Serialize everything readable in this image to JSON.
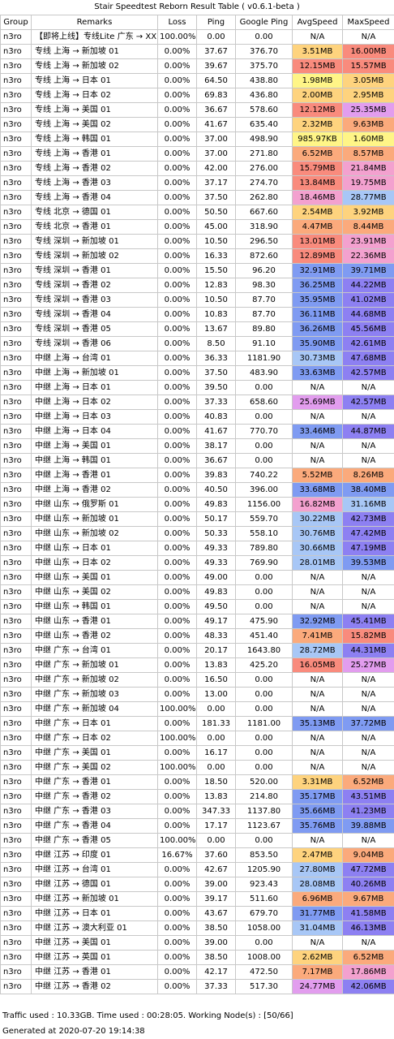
{
  "title": "Stair Speedtest Reborn Result Table ( v0.6.1-beta )",
  "columns": [
    "Group",
    "Remarks",
    "Loss",
    "Ping",
    "Google Ping",
    "AvgSpeed",
    "MaxSpeed"
  ],
  "rows": [
    [
      "n3ro",
      "【即将上线】专线Lite 广东 → XX",
      "100.00%",
      "0.00",
      "0.00",
      "N/A",
      "N/A"
    ],
    [
      "n3ro",
      "专线 上海 → 新加坡 01",
      "0.00%",
      "37.67",
      "376.70",
      "3.51MB",
      "16.00MB"
    ],
    [
      "n3ro",
      "专线 上海 → 新加坡 02",
      "0.00%",
      "39.67",
      "375.70",
      "12.15MB",
      "15.57MB"
    ],
    [
      "n3ro",
      "专线 上海 → 日本 01",
      "0.00%",
      "64.50",
      "438.80",
      "1.98MB",
      "3.05MB"
    ],
    [
      "n3ro",
      "专线 上海 → 日本 02",
      "0.00%",
      "69.83",
      "436.80",
      "2.00MB",
      "2.95MB"
    ],
    [
      "n3ro",
      "专线 上海 → 美国 01",
      "0.00%",
      "36.67",
      "578.60",
      "12.12MB",
      "25.35MB"
    ],
    [
      "n3ro",
      "专线 上海 → 美国 02",
      "0.00%",
      "41.67",
      "635.40",
      "2.32MB",
      "9.63MB"
    ],
    [
      "n3ro",
      "专线 上海 → 韩国 01",
      "0.00%",
      "37.00",
      "498.90",
      "985.97KB",
      "1.60MB"
    ],
    [
      "n3ro",
      "专线 上海 → 香港 01",
      "0.00%",
      "37.00",
      "271.80",
      "6.52MB",
      "8.57MB"
    ],
    [
      "n3ro",
      "专线 上海 → 香港 02",
      "0.00%",
      "42.00",
      "276.00",
      "15.79MB",
      "21.84MB"
    ],
    [
      "n3ro",
      "专线 上海 → 香港 03",
      "0.00%",
      "37.17",
      "274.70",
      "13.84MB",
      "19.75MB"
    ],
    [
      "n3ro",
      "专线 上海 → 香港 04",
      "0.00%",
      "37.50",
      "262.80",
      "18.46MB",
      "28.77MB"
    ],
    [
      "n3ro",
      "专线 北京 → 德国 01",
      "0.00%",
      "50.50",
      "667.60",
      "2.54MB",
      "3.92MB"
    ],
    [
      "n3ro",
      "专线 北京 → 香港 01",
      "0.00%",
      "45.00",
      "318.90",
      "4.47MB",
      "8.44MB"
    ],
    [
      "n3ro",
      "专线 深圳 → 新加坡 01",
      "0.00%",
      "10.50",
      "296.50",
      "13.01MB",
      "23.91MB"
    ],
    [
      "n3ro",
      "专线 深圳 → 新加坡 02",
      "0.00%",
      "16.33",
      "872.60",
      "12.89MB",
      "22.36MB"
    ],
    [
      "n3ro",
      "专线 深圳 → 香港 01",
      "0.00%",
      "15.50",
      "96.20",
      "32.91MB",
      "39.71MB"
    ],
    [
      "n3ro",
      "专线 深圳 → 香港 02",
      "0.00%",
      "12.83",
      "98.30",
      "36.25MB",
      "44.22MB"
    ],
    [
      "n3ro",
      "专线 深圳 → 香港 03",
      "0.00%",
      "10.50",
      "87.70",
      "35.95MB",
      "41.02MB"
    ],
    [
      "n3ro",
      "专线 深圳 → 香港 04",
      "0.00%",
      "10.83",
      "87.70",
      "36.11MB",
      "44.68MB"
    ],
    [
      "n3ro",
      "专线 深圳 → 香港 05",
      "0.00%",
      "13.67",
      "89.80",
      "36.26MB",
      "45.56MB"
    ],
    [
      "n3ro",
      "专线 深圳 → 香港 06",
      "0.00%",
      "8.50",
      "91.10",
      "35.90MB",
      "42.61MB"
    ],
    [
      "n3ro",
      "中继 上海 → 台湾 01",
      "0.00%",
      "36.33",
      "1181.90",
      "30.73MB",
      "47.68MB"
    ],
    [
      "n3ro",
      "中继 上海 → 新加坡 01",
      "0.00%",
      "37.50",
      "483.90",
      "33.63MB",
      "42.57MB"
    ],
    [
      "n3ro",
      "中继 上海 → 日本 01",
      "0.00%",
      "39.50",
      "0.00",
      "N/A",
      "N/A"
    ],
    [
      "n3ro",
      "中继 上海 → 日本 02",
      "0.00%",
      "37.33",
      "658.60",
      "25.69MB",
      "42.57MB"
    ],
    [
      "n3ro",
      "中继 上海 → 日本 03",
      "0.00%",
      "40.83",
      "0.00",
      "N/A",
      "N/A"
    ],
    [
      "n3ro",
      "中继 上海 → 日本 04",
      "0.00%",
      "41.67",
      "770.70",
      "33.46MB",
      "44.87MB"
    ],
    [
      "n3ro",
      "中继 上海 → 美国 01",
      "0.00%",
      "38.17",
      "0.00",
      "N/A",
      "N/A"
    ],
    [
      "n3ro",
      "中继 上海 → 韩国 01",
      "0.00%",
      "36.67",
      "0.00",
      "N/A",
      "N/A"
    ],
    [
      "n3ro",
      "中继 上海 → 香港 01",
      "0.00%",
      "39.83",
      "740.22",
      "5.52MB",
      "8.26MB"
    ],
    [
      "n3ro",
      "中继 上海 → 香港 02",
      "0.00%",
      "40.50",
      "396.00",
      "33.68MB",
      "38.40MB"
    ],
    [
      "n3ro",
      "中继 山东 → 俄罗斯 01",
      "0.00%",
      "49.83",
      "1156.00",
      "16.82MB",
      "31.16MB"
    ],
    [
      "n3ro",
      "中继 山东 → 新加坡 01",
      "0.00%",
      "50.17",
      "559.70",
      "30.22MB",
      "42.73MB"
    ],
    [
      "n3ro",
      "中继 山东 → 新加坡 02",
      "0.00%",
      "50.33",
      "558.10",
      "30.76MB",
      "47.42MB"
    ],
    [
      "n3ro",
      "中继 山东 → 日本 01",
      "0.00%",
      "49.33",
      "789.80",
      "30.66MB",
      "47.19MB"
    ],
    [
      "n3ro",
      "中继 山东 → 日本 02",
      "0.00%",
      "49.33",
      "769.90",
      "28.01MB",
      "39.53MB"
    ],
    [
      "n3ro",
      "中继 山东 → 美国 01",
      "0.00%",
      "49.00",
      "0.00",
      "N/A",
      "N/A"
    ],
    [
      "n3ro",
      "中继 山东 → 美国 02",
      "0.00%",
      "49.83",
      "0.00",
      "N/A",
      "N/A"
    ],
    [
      "n3ro",
      "中继 山东 → 韩国 01",
      "0.00%",
      "49.50",
      "0.00",
      "N/A",
      "N/A"
    ],
    [
      "n3ro",
      "中继 山东 → 香港 01",
      "0.00%",
      "49.17",
      "475.90",
      "32.92MB",
      "45.41MB"
    ],
    [
      "n3ro",
      "中继 山东 → 香港 02",
      "0.00%",
      "48.33",
      "451.40",
      "7.41MB",
      "15.82MB"
    ],
    [
      "n3ro",
      "中继 广东 → 台湾 01",
      "0.00%",
      "20.17",
      "1643.80",
      "28.72MB",
      "44.31MB"
    ],
    [
      "n3ro",
      "中继 广东 → 新加坡 01",
      "0.00%",
      "13.83",
      "425.20",
      "16.05MB",
      "25.27MB"
    ],
    [
      "n3ro",
      "中继 广东 → 新加坡 02",
      "0.00%",
      "16.50",
      "0.00",
      "N/A",
      "N/A"
    ],
    [
      "n3ro",
      "中继 广东 → 新加坡 03",
      "0.00%",
      "13.00",
      "0.00",
      "N/A",
      "N/A"
    ],
    [
      "n3ro",
      "中继 广东 → 新加坡 04",
      "100.00%",
      "0.00",
      "0.00",
      "N/A",
      "N/A"
    ],
    [
      "n3ro",
      "中继 广东 → 日本 01",
      "0.00%",
      "181.33",
      "1181.00",
      "35.13MB",
      "37.72MB"
    ],
    [
      "n3ro",
      "中继 广东 → 日本 02",
      "100.00%",
      "0.00",
      "0.00",
      "N/A",
      "N/A"
    ],
    [
      "n3ro",
      "中继 广东 → 美国 01",
      "0.00%",
      "16.17",
      "0.00",
      "N/A",
      "N/A"
    ],
    [
      "n3ro",
      "中继 广东 → 美国 02",
      "100.00%",
      "0.00",
      "0.00",
      "N/A",
      "N/A"
    ],
    [
      "n3ro",
      "中继 广东 → 香港 01",
      "0.00%",
      "18.50",
      "520.00",
      "3.31MB",
      "6.52MB"
    ],
    [
      "n3ro",
      "中继 广东 → 香港 02",
      "0.00%",
      "13.83",
      "214.80",
      "35.17MB",
      "43.51MB"
    ],
    [
      "n3ro",
      "中继 广东 → 香港 03",
      "0.00%",
      "347.33",
      "1137.80",
      "35.66MB",
      "41.23MB"
    ],
    [
      "n3ro",
      "中继 广东 → 香港 04",
      "0.00%",
      "17.17",
      "1123.67",
      "35.76MB",
      "39.88MB"
    ],
    [
      "n3ro",
      "中继 广东 → 香港 05",
      "100.00%",
      "0.00",
      "0.00",
      "N/A",
      "N/A"
    ],
    [
      "n3ro",
      "中继 江苏 → 印度 01",
      "16.67%",
      "37.60",
      "853.50",
      "2.47MB",
      "9.04MB"
    ],
    [
      "n3ro",
      "中继 江苏 → 台湾 01",
      "0.00%",
      "42.67",
      "1205.90",
      "27.80MB",
      "47.72MB"
    ],
    [
      "n3ro",
      "中继 江苏 → 德国 01",
      "0.00%",
      "39.00",
      "923.43",
      "28.08MB",
      "40.26MB"
    ],
    [
      "n3ro",
      "中继 江苏 → 新加坡 01",
      "0.00%",
      "39.17",
      "511.60",
      "6.96MB",
      "9.67MB"
    ],
    [
      "n3ro",
      "中继 江苏 → 日本 01",
      "0.00%",
      "43.67",
      "679.70",
      "31.77MB",
      "41.58MB"
    ],
    [
      "n3ro",
      "中继 江苏 → 澳大利亚 01",
      "0.00%",
      "38.50",
      "1058.00",
      "31.04MB",
      "46.13MB"
    ],
    [
      "n3ro",
      "中继 江苏 → 美国 01",
      "0.00%",
      "39.00",
      "0.00",
      "N/A",
      "N/A"
    ],
    [
      "n3ro",
      "中继 江苏 → 英国 01",
      "0.00%",
      "38.50",
      "1008.00",
      "2.62MB",
      "6.52MB"
    ],
    [
      "n3ro",
      "中继 江苏 → 香港 01",
      "0.00%",
      "42.17",
      "472.50",
      "7.17MB",
      "17.86MB"
    ],
    [
      "n3ro",
      "中继 江苏 → 香港 02",
      "0.00%",
      "37.33",
      "517.30",
      "24.77MB",
      "42.06MB"
    ]
  ],
  "speed_colors": {
    "na": "#ffffff",
    "yellow": "#fff587",
    "light_orange": "#fed37e",
    "orange": "#fbaa7c",
    "red": "#f98b7d",
    "pink": "#f3a1cf",
    "violet": "#e29dee",
    "light_blue": "#a8c7f6",
    "blue": "#7f9bf2",
    "deep_blue": "#8d80f2"
  },
  "footer": {
    "traffic": "Traffic used : 10.33GB. Time used : 00:28:05. Working Node(s) : [50/66]",
    "generated": "Generated at 2020-07-20 19:14:38"
  }
}
